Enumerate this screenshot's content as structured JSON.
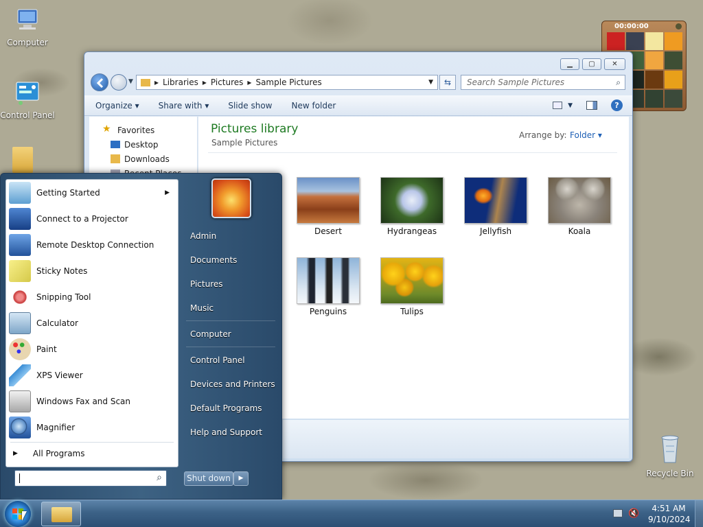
{
  "desktop": {
    "icons": [
      {
        "label": "Computer",
        "icon": "computer-icon"
      },
      {
        "label": "Control Panel",
        "icon": "control-panel-icon"
      },
      {
        "label": "Recycle Bin",
        "icon": "recycle-bin-icon"
      }
    ]
  },
  "explorer": {
    "breadcrumb": [
      "Libraries",
      "Pictures",
      "Sample Pictures"
    ],
    "search_placeholder": "Search Sample Pictures",
    "toolbar": {
      "organize": "Organize",
      "share": "Share with",
      "slideshow": "Slide show",
      "new_folder": "New folder"
    },
    "nav": {
      "favorites": "Favorites",
      "desktop": "Desktop",
      "downloads": "Downloads",
      "recent": "Recent Places"
    },
    "library_title": "Pictures library",
    "library_subtitle": "Sample Pictures",
    "arrange_label": "Arrange by:",
    "arrange_value": "Folder",
    "items": [
      {
        "name": "Desert"
      },
      {
        "name": "Hydrangeas"
      },
      {
        "name": "Jellyfish"
      },
      {
        "name": "Koala"
      },
      {
        "name": "Penguins"
      },
      {
        "name": "Tulips"
      }
    ]
  },
  "gadget": {
    "timer": "00:00:00"
  },
  "start_menu": {
    "programs": [
      {
        "label": "Getting Started",
        "has_arrow": true
      },
      {
        "label": "Connect to a Projector"
      },
      {
        "label": "Remote Desktop Connection"
      },
      {
        "label": "Sticky Notes"
      },
      {
        "label": "Snipping Tool"
      },
      {
        "label": "Calculator"
      },
      {
        "label": "Paint"
      },
      {
        "label": "XPS Viewer"
      },
      {
        "label": "Windows Fax and Scan"
      },
      {
        "label": "Magnifier"
      }
    ],
    "all_programs": "All Programs",
    "right_items": [
      "Admin",
      "Documents",
      "Pictures",
      "Music",
      "Computer",
      "Control Panel",
      "Devices and Printers",
      "Default Programs",
      "Help and Support"
    ],
    "shutdown": "Shut down"
  },
  "taskbar": {
    "time": "4:51 AM",
    "date": "9/10/2024"
  }
}
